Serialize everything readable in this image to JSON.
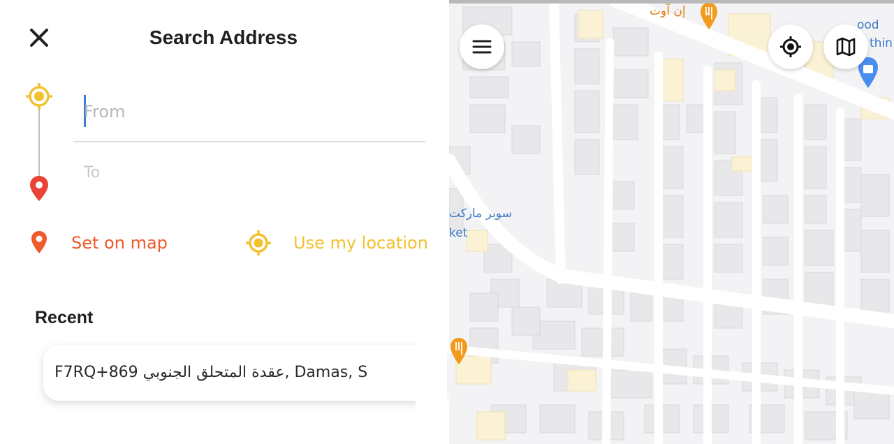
{
  "header": {
    "title": "Search Address"
  },
  "route": {
    "from_placeholder": "From",
    "to_placeholder": "To"
  },
  "actions": {
    "set_on_map": "Set on map",
    "use_my_location": "Use my location"
  },
  "recent": {
    "heading": "Recent",
    "items": [
      {
        "address": "F7RQ+869 عقدة المتحلق الجنوبي, Damas, S"
      }
    ]
  },
  "map": {
    "labels": {
      "restaurant_top": "إن آوت",
      "market_arabic": "سوبر ماركت",
      "market_latin": "ket",
      "poi_right_1": "ood",
      "poi_right_2": "thin"
    }
  },
  "colors": {
    "accent_orange": "#ee5a2a",
    "accent_yellow": "#f2c12e",
    "pin_red": "#ea4335",
    "poi_orange": "#f29a1b",
    "poi_blue": "#4a8df0"
  },
  "icons": {
    "close": "close-icon",
    "from": "crosshair-icon",
    "to": "map-pin-icon",
    "menu": "hamburger-menu-icon",
    "gps": "my-location-icon",
    "layers": "map-icon"
  }
}
